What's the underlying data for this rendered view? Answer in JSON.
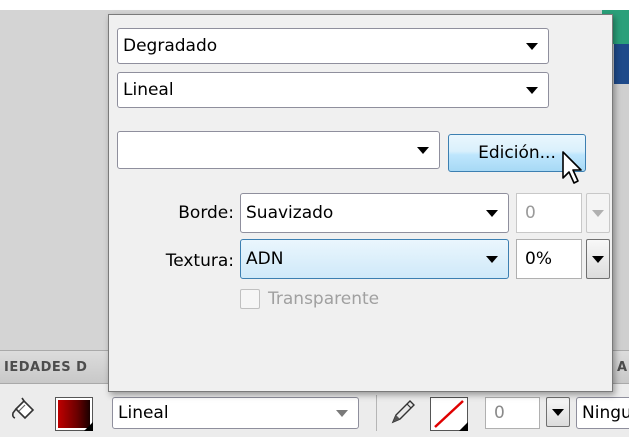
{
  "background": {
    "panel_header_left": "IEDADES D",
    "panel_header_right": "A"
  },
  "toolbar": {
    "fill_color": "#8b0000",
    "line_style": "Lineal",
    "stroke_width": "0",
    "cap_style": "Ningu"
  },
  "popup": {
    "fill_type": "Degradado",
    "gradient_type": "Lineal",
    "preset": "",
    "edit_button": "Edición...",
    "border_label": "Borde:",
    "border_value": "Suavizado",
    "border_amount": "0",
    "texture_label": "Textura:",
    "texture_value": "ADN",
    "texture_percent": "0%",
    "transparent_label": "Transparente",
    "transparent_checked": false
  },
  "colors": {
    "accent_blue": "#3c7fb1",
    "fill_red": "#c00000",
    "stroke_red": "#e00000"
  }
}
